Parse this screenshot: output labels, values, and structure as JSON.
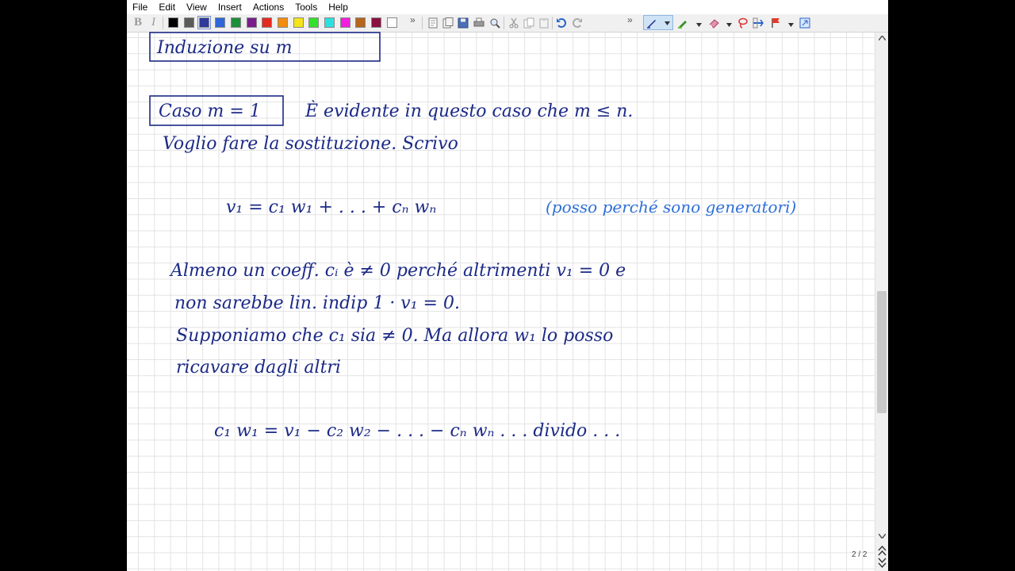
{
  "menu": [
    "File",
    "Edit",
    "View",
    "Insert",
    "Actions",
    "Tools",
    "Help"
  ],
  "toolbar": {
    "bold": "B",
    "italic": "I",
    "more": "»",
    "colors": [
      "#000000",
      "#5a5a5a",
      "#2e3b9a",
      "#2f66d9",
      "#1e8f3a",
      "#7a1e8c",
      "#e52a1e",
      "#f28c0f",
      "#f5e51a",
      "#36e02a",
      "#2de0e0",
      "#f21ddd",
      "#b5651d",
      "#8a1040",
      "#ffffff"
    ],
    "icons": [
      "new-page-icon",
      "new-page-copy-icon",
      "save-icon",
      "print-icon",
      "zoom-icon",
      "cut-icon",
      "copy-icon",
      "paste-icon",
      "undo-icon",
      "redo-icon",
      "pen-icon",
      "highlighter-icon",
      "eraser-icon",
      "lasso-icon",
      "insert-space-icon",
      "flag-icon",
      "fit-icon"
    ]
  },
  "notes": {
    "heading": "Induzione su m",
    "case_label": "Caso m = 1",
    "line1": "È evidente in questo caso che m ≤ n.",
    "line2": "Voglio fare la sostituzione. Scrivo",
    "eq1": "v₁ = c₁ w₁ + . . . + cₙ wₙ",
    "eq1_note": "(posso perché sono generatori)",
    "line3": "Almeno un coeff. cᵢ è ≠ 0 perché altrimenti v₁ = 0 e",
    "line4": "non sarebbe lin. indip      1 · v₁ = 0.",
    "line5": "Supponiamo che c₁ sia ≠ 0. Ma allora w₁ lo posso",
    "line6": "ricavare dagli altri",
    "eq2": "c₁ w₁  =  v₁ − c₂ w₂ − . . . − cₙ wₙ    . . .  divido . . ."
  },
  "page_indicator": "2 / 2"
}
